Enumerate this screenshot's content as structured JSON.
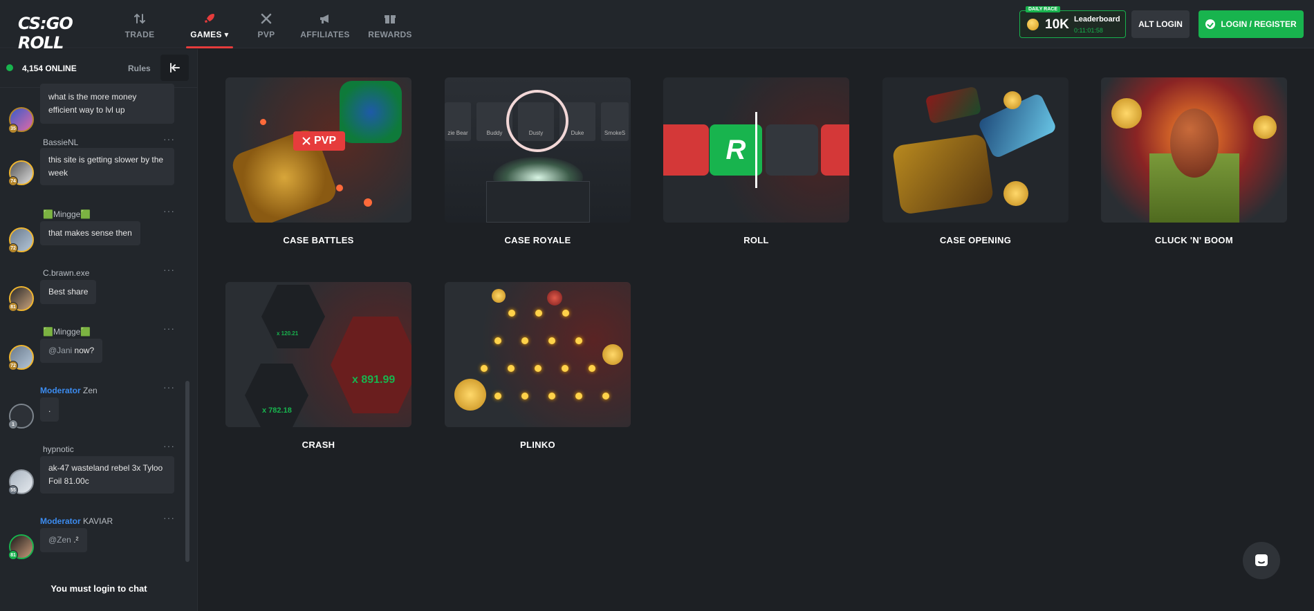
{
  "header": {
    "logo": "CS:GO ROLL",
    "nav": [
      {
        "label": "TRADE",
        "icon": "trade-arrows-icon",
        "active": false
      },
      {
        "label": "GAMES",
        "icon": "rocket-icon",
        "active": true
      },
      {
        "label": "PVP",
        "icon": "crossed-swords-icon",
        "active": false
      },
      {
        "label": "AFFILIATES",
        "icon": "megaphone-icon",
        "active": false
      },
      {
        "label": "REWARDS",
        "icon": "gift-icon",
        "active": false
      }
    ],
    "daily_race": {
      "tag": "DAILY RACE",
      "amount": "10K",
      "label": "Leaderboard",
      "timer": "0:11:01:58"
    },
    "alt_login": "ALT LOGIN",
    "login": "LOGIN / REGISTER"
  },
  "sidebar": {
    "online": "4,154 ONLINE",
    "rules": "Rules",
    "messages": [
      {
        "user": "",
        "text": "what is the more money efficient way to lvl up",
        "level": "35"
      },
      {
        "user": "BassieNL",
        "text": "this site is getting slower by the week",
        "level": "74"
      },
      {
        "user": "🟩Mingge🟩",
        "text": "that makes sense then",
        "level": "72"
      },
      {
        "user": "C.brawn.exe",
        "text": "Best share",
        "level": "81"
      },
      {
        "user": "🟩Mingge🟩",
        "mention": "@Jani",
        "text": "now?",
        "level": "72"
      },
      {
        "role": "Moderator",
        "user": "Zen",
        "text": ".",
        "level": "1"
      },
      {
        "user": "hypnotic",
        "text": "ak-47 wasteland rebel 3x Tyloo Foil 81.00c",
        "level": "55"
      },
      {
        "role": "Moderator",
        "user": "KAVIAR",
        "mention": "@Zen",
        "text": ".²",
        "level": "81"
      }
    ],
    "must_login": "You must login to chat"
  },
  "games": [
    {
      "label": "CASE BATTLES"
    },
    {
      "label": "CASE ROYALE"
    },
    {
      "label": "ROLL"
    },
    {
      "label": "CASE OPENING"
    },
    {
      "label": "CLUCK 'N' BOOM"
    },
    {
      "label": "CRASH"
    },
    {
      "label": "PLINKO"
    }
  ],
  "art": {
    "pvp_badge": "PVP",
    "royale_players": [
      "zie Bear",
      "Buddy",
      "Dusty",
      "Duke",
      "SmokeS"
    ],
    "royale_levels": [
      "76",
      "",
      "99",
      "12"
    ],
    "crash_values": [
      "x 120.21",
      "x 891.99",
      "x 782.18"
    ]
  },
  "colors": {
    "accent_red": "#e63c3c",
    "accent_green": "#18b44e",
    "moderator_blue": "#3c8cf0"
  }
}
